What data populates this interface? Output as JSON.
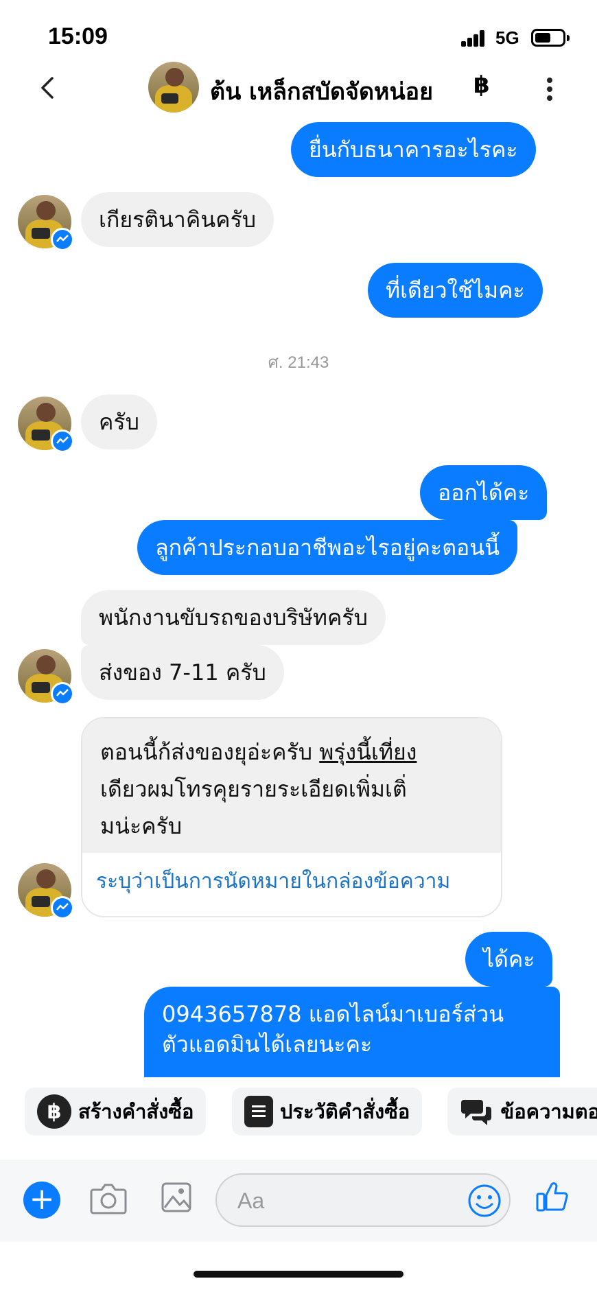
{
  "status_bar": {
    "time": "15:09",
    "network": "5G"
  },
  "header": {
    "contact_name": "ต้น เหล็กสบัดจัดหน่อย",
    "currency_symbol": "฿"
  },
  "messages": {
    "m1": "ยื่นกับธนาคารอะไรคะ",
    "m2": "เกียรตินาคินครับ",
    "m3": "ที่เดียวใช้ไมคะ",
    "timestamp": "ศ. 21:43",
    "m4": "ครับ",
    "m5": "ออกได้คะ",
    "m6": "ลูกค้าประกอบอาชีพอะไรอยู่คะตอนนี้",
    "m7": "พนักงานขับรถของบริษัทครับ",
    "m8": "ส่งของ 7-11 ครับ",
    "m9": {
      "line1_a": "ตอนนี้ก้ส่งของยุอ่ะครับ ",
      "line1_b": "พรุ่งนี้เที่ยง",
      "line2": "เดียวผมโทรคุยรายระเอียดเพิ่มเติ่",
      "line3": "มน่ะครับ",
      "action": "ระบุว่าเป็นการนัดหมายในกล่องข้อความ"
    },
    "m10": "ได้คะ",
    "m11_line1": "0943657878 แอดไลน์มาเบอร์ส่วน",
    "m11_line2": "ตัวแอดมินได้เลยนะคะ"
  },
  "quick_replies": [
    {
      "label": "สร้างคำสั่งซื้อ",
      "icon": "baht-icon"
    },
    {
      "label": "ประวัติคำสั่งซื้อ",
      "icon": "document-icon"
    },
    {
      "label": "ข้อความตอ",
      "icon": "chat-bubbles-icon"
    }
  ],
  "composer": {
    "placeholder": "Aa"
  },
  "colors": {
    "accent": "#0a7cff",
    "incoming_bubble": "#f0f0f0",
    "link": "#1a73c8"
  }
}
